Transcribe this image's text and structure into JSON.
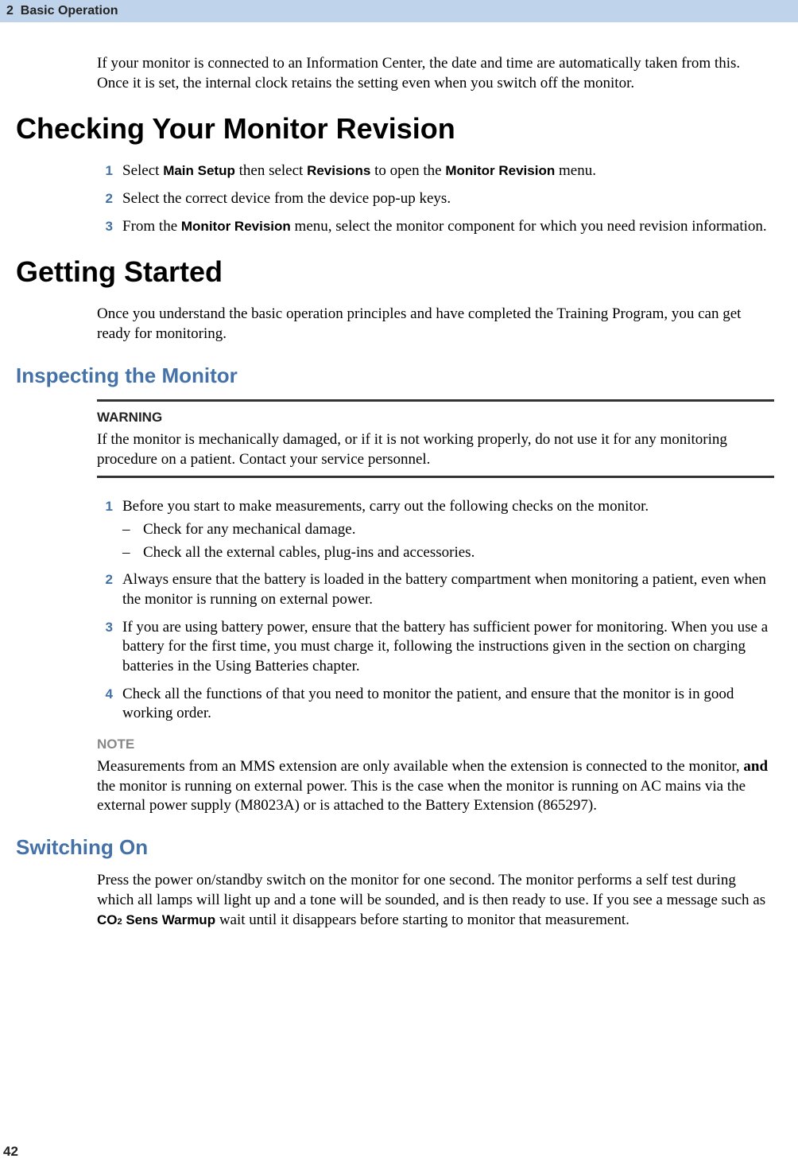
{
  "header": {
    "chapter_num": "2",
    "chapter_title": "Basic Operation"
  },
  "intro_para": "If your monitor is connected to an Information Center, the date and time are automatically taken from this. Once it is set, the internal clock retains the setting even when you switch off the monitor.",
  "sec1": {
    "title": "Checking Your Monitor Revision",
    "steps": {
      "s1": {
        "num": "1",
        "pre": "Select ",
        "b1": "Main Setup",
        "mid": " then select ",
        "b2": "Revisions",
        "mid2": " to open the ",
        "b3": "Monitor Revision",
        "post": " menu."
      },
      "s2": {
        "num": "2",
        "text": "Select the correct device from the device pop-up keys."
      },
      "s3": {
        "num": "3",
        "pre": "From the ",
        "b1": "Monitor Revision",
        "post": " menu, select the monitor component for which you need revision information."
      }
    }
  },
  "sec2": {
    "title": "Getting Started",
    "intro": "Once you understand the basic operation principles and have completed the Training Program, you can get ready for monitoring.",
    "sub1": {
      "title": "Inspecting the Monitor",
      "warn_label": "WARNING",
      "warn_text": "If the monitor is mechanically damaged, or if it is not working properly, do not use it for any monitoring procedure on a patient. Contact your service personnel.",
      "steps": {
        "s1": {
          "num": "1",
          "text": "Before you start to make measurements, carry out the following checks on the monitor.",
          "d1": "Check for any mechanical damage.",
          "d2": "Check all the external cables, plug-ins and accessories."
        },
        "s2": {
          "num": "2",
          "text": "Always ensure that the battery is loaded in the battery compartment when monitoring a patient, even when the monitor is running on external power."
        },
        "s3": {
          "num": "3",
          "text": "If you are using battery power, ensure that the battery has sufficient power for monitoring. When you use a battery for the first time, you must charge it, following the instructions given in the section on charging batteries in the Using Batteries chapter."
        },
        "s4": {
          "num": "4",
          "text": "Check all the functions of that you need to monitor the patient, and ensure that the monitor is in good working order."
        }
      },
      "note_label": "NOTE",
      "note_pre": "Measurements from an MMS extension are only available when the extension is connected to the monitor, ",
      "note_bold": "and",
      "note_post": " the monitor is running on external power. This is the case when the monitor is running on AC mains via the external power supply (M8023A) or is attached to the Battery Extension (865297)."
    },
    "sub2": {
      "title": "Switching On",
      "pre": "Press the power on/standby switch on the monitor for one second. The monitor performs a self test during which all lamps will light up and a tone will be sounded, and is then ready to use. If you see a message such as ",
      "b1": "CO",
      "sub": "2",
      "b2": " Sens Warmup",
      "post": " wait until it disappears before starting to monitor that measurement."
    }
  },
  "page_num": "42"
}
